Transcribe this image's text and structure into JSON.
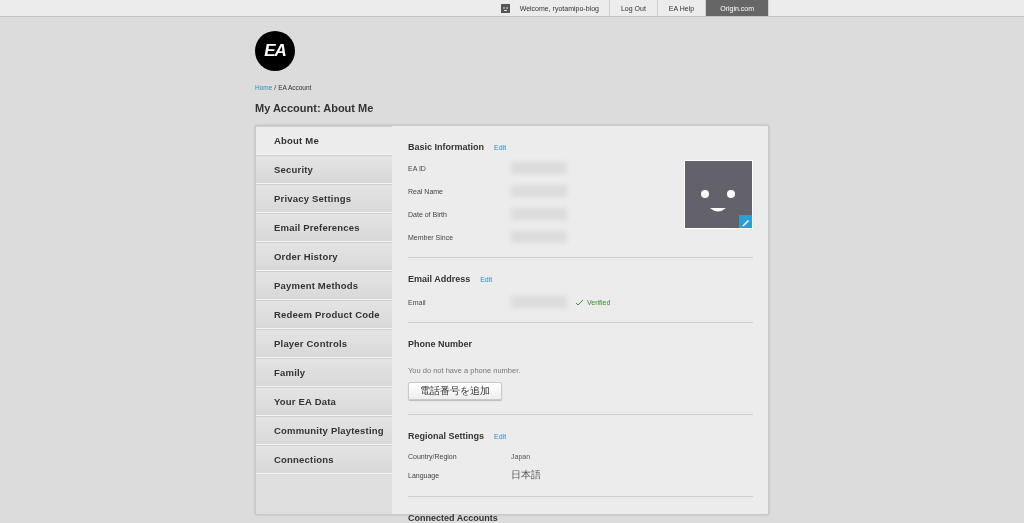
{
  "top_bar": {
    "welcome": "Welcome, ryotamipo-blog",
    "links": [
      {
        "label": "Log Out",
        "selected": false
      },
      {
        "label": "EA Help",
        "selected": false
      },
      {
        "label": "Origin.com",
        "selected": true
      }
    ]
  },
  "logo": {
    "text": "EA"
  },
  "breadcrumb": {
    "separator": "/",
    "items": [
      {
        "label": "Home",
        "kind": "link"
      },
      {
        "label": "EA Account",
        "kind": "current"
      }
    ]
  },
  "page_title": "My Account: About Me",
  "sidebar": {
    "items": [
      {
        "label": "About Me",
        "selected": true
      },
      {
        "label": "Security",
        "selected": false
      },
      {
        "label": "Privacy Settings",
        "selected": false
      },
      {
        "label": "Email Preferences",
        "selected": false
      },
      {
        "label": "Order History",
        "selected": false
      },
      {
        "label": "Payment Methods",
        "selected": false
      },
      {
        "label": "Redeem Product Code",
        "selected": false
      },
      {
        "label": "Player Controls",
        "selected": false
      },
      {
        "label": "Family",
        "selected": false
      },
      {
        "label": "Your EA Data",
        "selected": false
      },
      {
        "label": "Community Playtesting",
        "selected": false
      },
      {
        "label": "Connections",
        "selected": false
      }
    ]
  },
  "sections": [
    {
      "kind": "basic",
      "title": "Basic Information",
      "edit": "Edit",
      "avatar": true,
      "fields": [
        {
          "label": "EA ID",
          "blurred": true
        },
        {
          "label": "Real Name",
          "blurred": true
        },
        {
          "label": "Date of Birth",
          "blurred": true
        },
        {
          "label": "Member Since",
          "blurred": true
        }
      ]
    },
    {
      "kind": "fields",
      "title": "Email Address",
      "edit": "Edit",
      "fields": [
        {
          "label": "Email",
          "blurred": true,
          "badge": "Verified"
        }
      ]
    },
    {
      "kind": "phone",
      "title": "Phone Number",
      "message": "You do not have a phone number.",
      "button": "電話番号を追加"
    },
    {
      "kind": "fields",
      "title": "Regional Settings",
      "edit": "Edit",
      "fields": [
        {
          "label": "Country/Region",
          "blurred": false,
          "value": "Japan"
        },
        {
          "label": "Language",
          "blurred": false,
          "value": "日本語"
        }
      ]
    },
    {
      "kind": "title",
      "title": "Connected Accounts"
    }
  ]
}
